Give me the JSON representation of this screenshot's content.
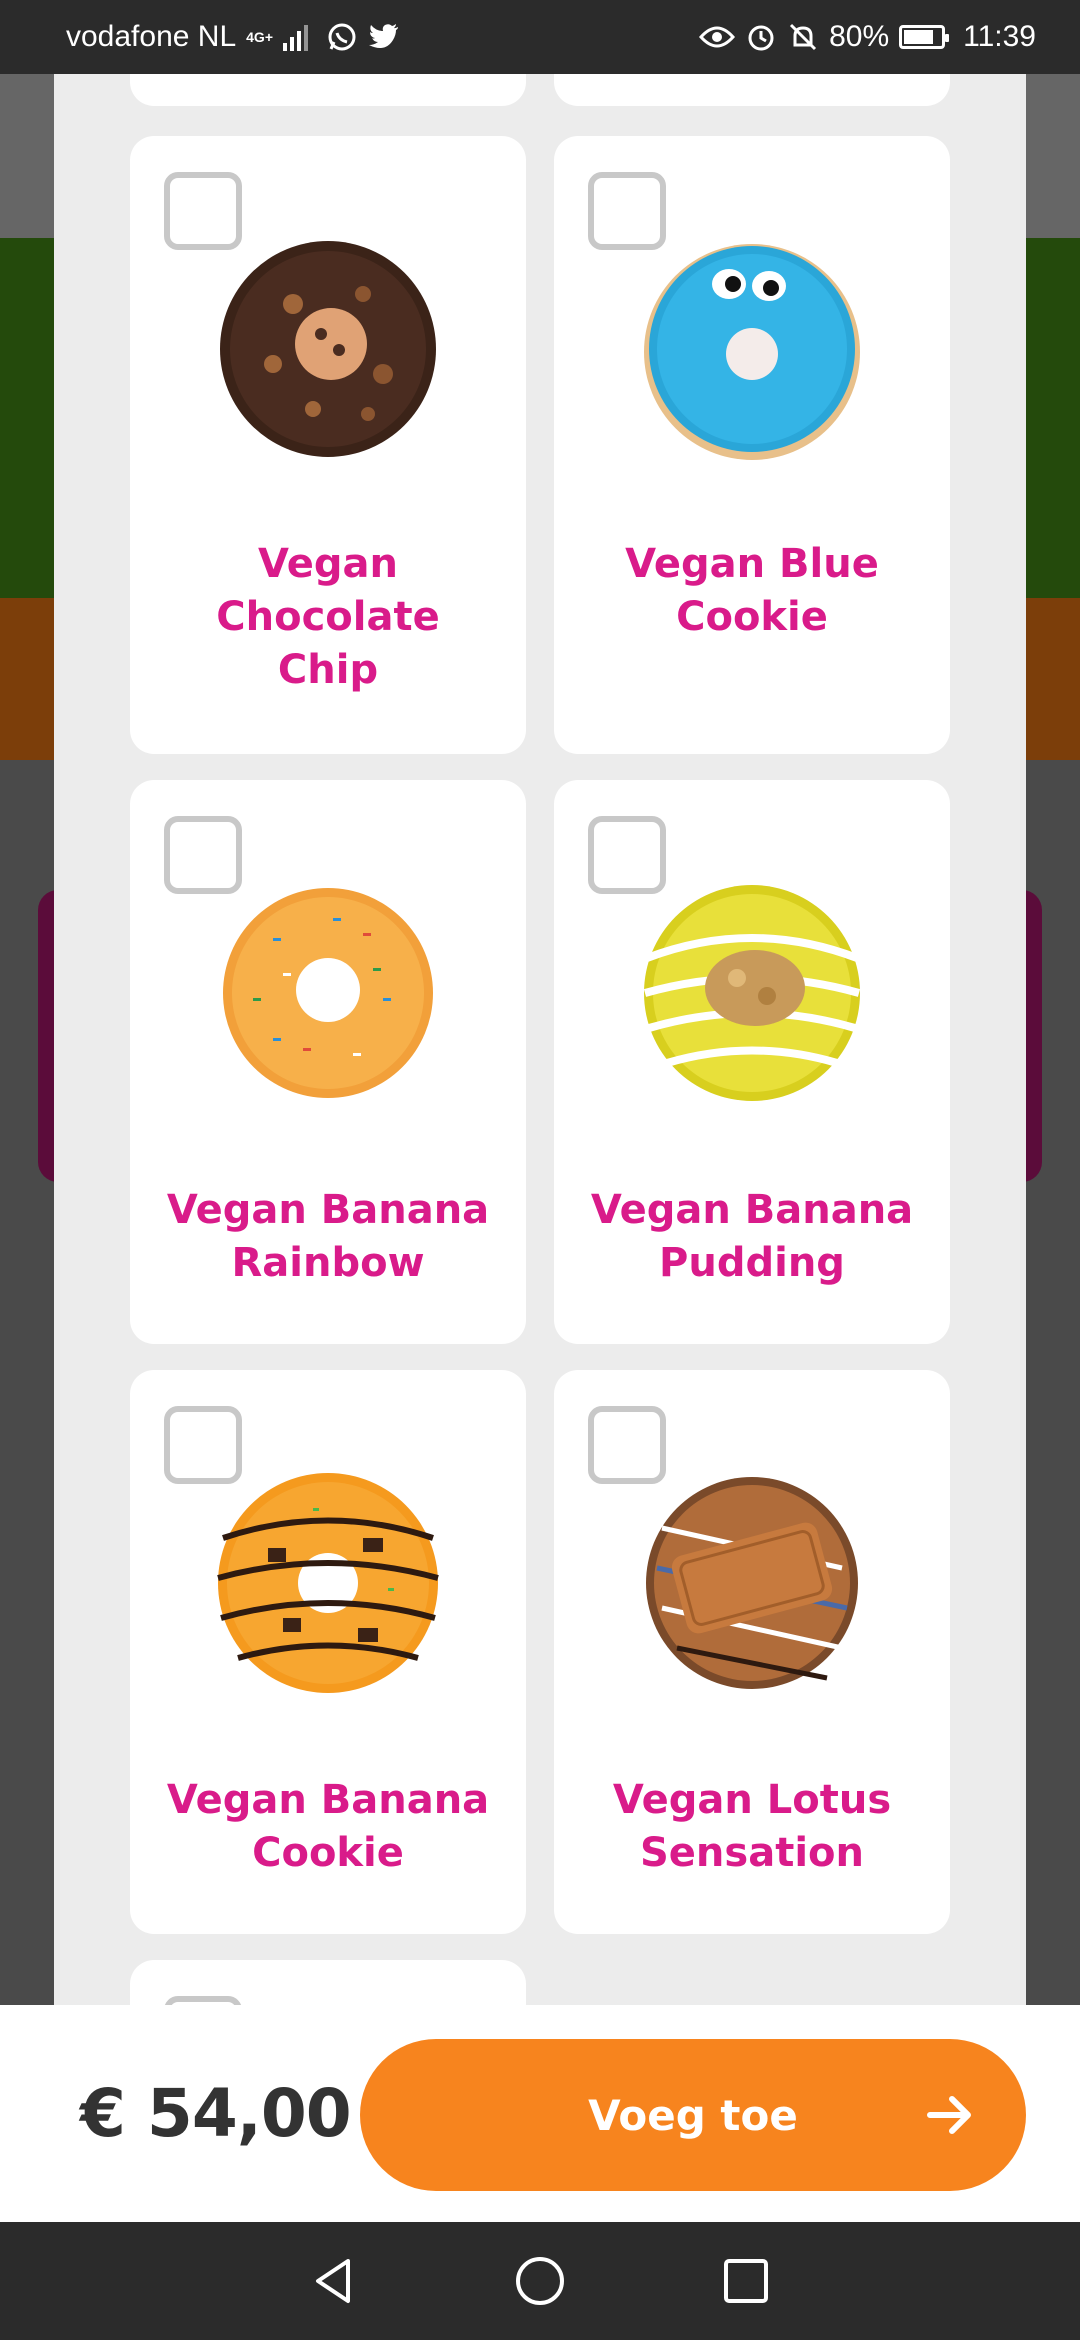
{
  "status_bar": {
    "carrier": "vodafone NL",
    "network": "4G+",
    "battery_percent": 80,
    "battery_label": "80%",
    "time": "11:39"
  },
  "products": [
    {
      "name": "Vegan Chocolate Chip",
      "lines": [
        "Vegan",
        "Chocolate",
        "Chip"
      ],
      "checked": false,
      "icon": "chocolate-chip-donut-image"
    },
    {
      "name": "Vegan Blue Cookie",
      "lines": [
        "Vegan Blue",
        "Cookie"
      ],
      "checked": false,
      "icon": "blue-cookie-donut-image"
    },
    {
      "name": "Vegan Banana Rainbow",
      "lines": [
        "Vegan Banana",
        "Rainbow"
      ],
      "checked": false,
      "icon": "rainbow-sprinkle-donut-image"
    },
    {
      "name": "Vegan Banana Pudding",
      "lines": [
        "Vegan Banana",
        "Pudding"
      ],
      "checked": false,
      "icon": "banana-pudding-donut-image"
    },
    {
      "name": "Vegan Banana Cookie",
      "lines": [
        "Vegan Banana",
        "Cookie"
      ],
      "checked": false,
      "icon": "banana-cookie-donut-image"
    },
    {
      "name": "Vegan Lotus Sensation",
      "lines": [
        "Vegan Lotus",
        "Sensation"
      ],
      "checked": false,
      "icon": "lotus-donut-image"
    }
  ],
  "footer": {
    "price": "€ 54,00",
    "add_label": "Voeg toe"
  },
  "colors": {
    "accent_orange": "#f7841e",
    "product_pink": "#d91b8a"
  }
}
